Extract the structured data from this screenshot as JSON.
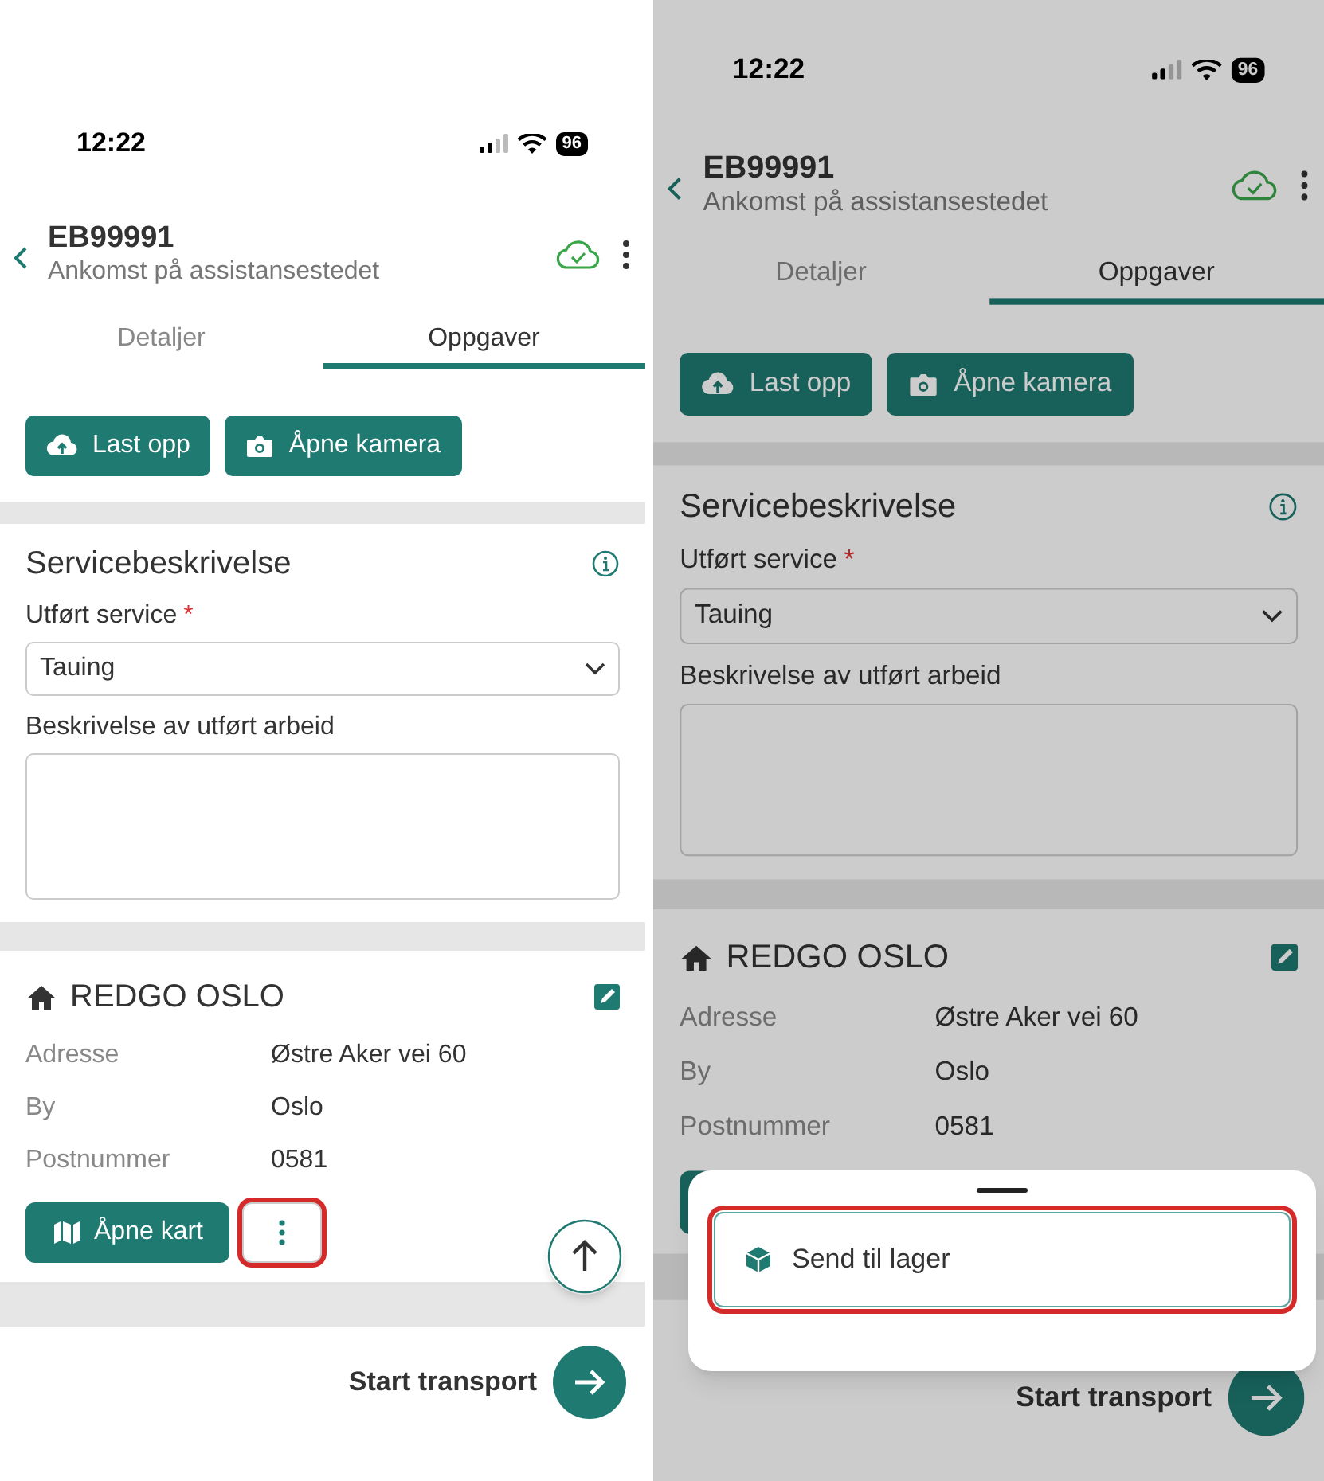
{
  "screens": [
    {
      "status_bar": {
        "time": "12:22",
        "battery": "96"
      },
      "header": {
        "id": "EB99991",
        "subtitle": "Ankomst på assistansestedet"
      },
      "tabs": [
        {
          "label": "Detaljer",
          "selected": false
        },
        {
          "label": "Oppgaver",
          "selected": true
        }
      ],
      "upload_buttons": [
        {
          "kind": "upload",
          "label": "Last opp"
        },
        {
          "kind": "camera",
          "label": "Åpne kamera"
        }
      ],
      "service": {
        "title": "Servicebeskrivelse",
        "field_label": "Utført service",
        "required_mark": "*",
        "select_value": "Tauing",
        "description_label": "Beskrivelse av utført arbeid"
      },
      "location": {
        "name": "REDGO OSLO",
        "rows": [
          {
            "label": "Adresse",
            "value": "Østre Aker vei 60"
          },
          {
            "label": "By",
            "value": "Oslo"
          },
          {
            "label": "Postnummer",
            "value": "0581"
          }
        ],
        "actions": [
          {
            "kind": "map",
            "label": "Åpne kart",
            "highlighted": false
          },
          {
            "kind": "more",
            "highlighted": true
          }
        ]
      },
      "scroll_top_button": true,
      "footer": {
        "label": "Start transport"
      }
    },
    {
      "dimmed": true,
      "status_bar": {
        "time": "12:22",
        "battery": "96"
      },
      "header": {
        "id": "EB99991",
        "subtitle": "Ankomst på assistansestedet"
      },
      "tabs": [
        {
          "label": "Detaljer",
          "selected": false
        },
        {
          "label": "Oppgaver",
          "selected": true
        }
      ],
      "upload_buttons": [
        {
          "kind": "upload",
          "label": "Last opp"
        },
        {
          "kind": "camera",
          "label": "Åpne kamera"
        }
      ],
      "service": {
        "title": "Servicebeskrivelse",
        "field_label": "Utført service",
        "required_mark": "*",
        "select_value": "Tauing",
        "description_label": "Beskrivelse av utført arbeid"
      },
      "location": {
        "name": "REDGO OSLO",
        "rows": [
          {
            "label": "Adresse",
            "value": "Østre Aker vei 60"
          },
          {
            "label": "By",
            "value": "Oslo"
          },
          {
            "label": "Postnummer",
            "value": "0581"
          }
        ],
        "actions": [
          {
            "kind": "map",
            "highlighted": false
          }
        ]
      },
      "footer": {
        "label": "Start transport"
      },
      "sheet": {
        "items": [
          {
            "label": "Send til lager",
            "highlighted": true
          }
        ]
      }
    }
  ]
}
